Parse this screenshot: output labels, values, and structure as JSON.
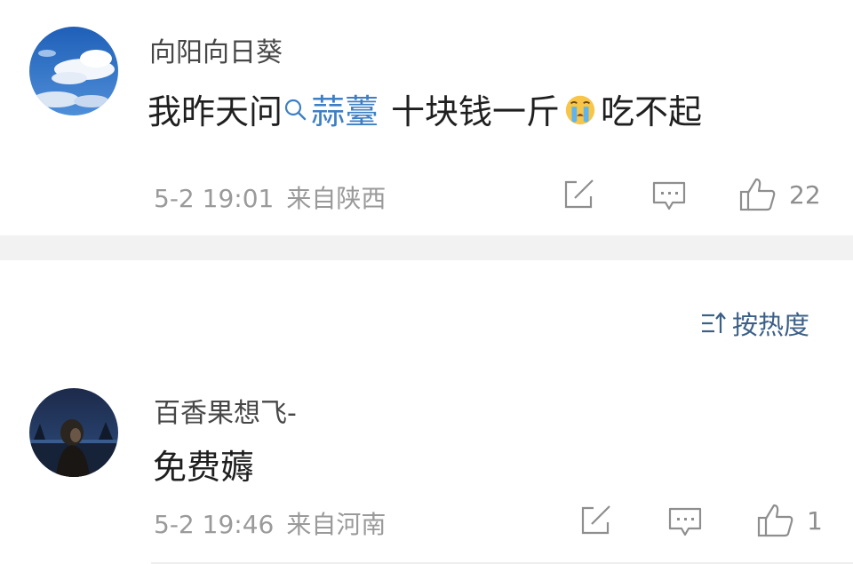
{
  "comments": [
    {
      "username": "向阳向日葵",
      "text_before": "我昨天问",
      "topic": "蒜薹",
      "text_middle": "十块钱一斤",
      "emoji": "crying-face",
      "text_after": "吃不起",
      "time": "5-2 19:01",
      "location": "来自陕西",
      "likes": "22"
    },
    {
      "username": "百香果想飞-",
      "text": "免费薅",
      "time": "5-2 19:46",
      "location": "来自河南",
      "likes": "1"
    }
  ],
  "sort": {
    "label": "按热度"
  },
  "colors": {
    "link": "#3d7fc4",
    "sort": "#3b5f87",
    "meta": "#9a9a9a",
    "separator": "#f2f2f2"
  }
}
